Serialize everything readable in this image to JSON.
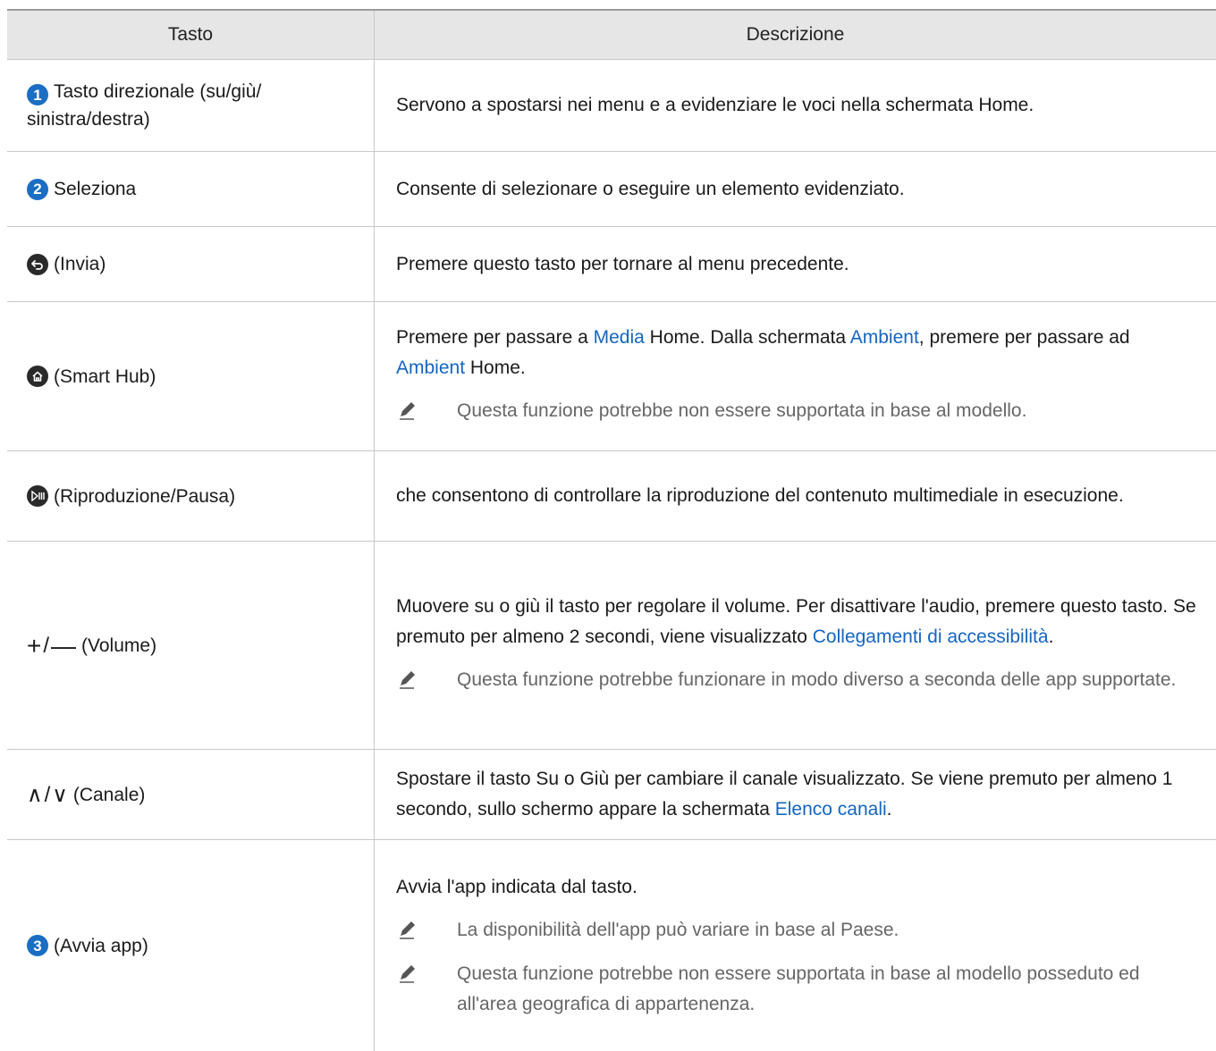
{
  "header": {
    "col_key": "Tasto",
    "col_desc": "Descrizione"
  },
  "rows": [
    {
      "key_badge": "1",
      "key_label": "Tasto direzionale (su/giù/ sinistra/destra)",
      "desc": "Servono a spostarsi nei menu e a evidenziare le voci nella schermata Home."
    },
    {
      "key_badge": "2",
      "key_label": "Seleziona",
      "desc": "Consente di selezionare o eseguire un elemento evidenziato."
    },
    {
      "key_icon": "return-icon",
      "key_label": "(Invia)",
      "desc": "Premere questo tasto per tornare al menu precedente."
    },
    {
      "key_icon": "home-icon",
      "key_label": "(Smart Hub)",
      "desc_parts": [
        "Premere per passare a ",
        "Media",
        " Home. Dalla schermata ",
        "Ambient",
        ", premere per passare ad ",
        "Ambient",
        " Home."
      ],
      "note": "Questa funzione potrebbe non essere supportata in base al modello."
    },
    {
      "key_icon": "play-pause-icon",
      "key_label": "(Riproduzione/Pausa)",
      "desc": "che consentono di controllare la riproduzione del contenuto multimediale in esecuzione."
    },
    {
      "key_symbols": [
        "+",
        "/",
        "—"
      ],
      "key_label": "(Volume)",
      "desc_parts": [
        "Muovere su o giù il tasto per regolare il volume. Per disattivare l'audio, premere questo tasto. Se premuto per almeno 2 secondi, viene visualizzato ",
        "Collegamenti di accessibilità",
        "."
      ],
      "note": "Questa funzione potrebbe funzionare in modo diverso a seconda delle app supportate."
    },
    {
      "key_symbols": [
        "∧",
        "/",
        "∨"
      ],
      "key_label": "(Canale)",
      "desc_parts": [
        "Spostare il tasto Su o Giù per cambiare il canale visualizzato. Se viene premuto per almeno 1 secondo, sullo schermo appare la schermata ",
        "Elenco canali",
        "."
      ]
    },
    {
      "key_badge": "3",
      "key_label": "(Avvia app)",
      "desc": "Avvia l'app indicata dal tasto.",
      "notes": [
        "La disponibilità dell'app può variare in base al Paese.",
        "Questa funzione potrebbe non essere supportata in base al modello posseduto ed all'area geografica di appartenenza."
      ]
    }
  ],
  "colors": {
    "link": "#1565c0",
    "badge": "#1b6ec2",
    "header_bg": "#e6e6e6"
  }
}
